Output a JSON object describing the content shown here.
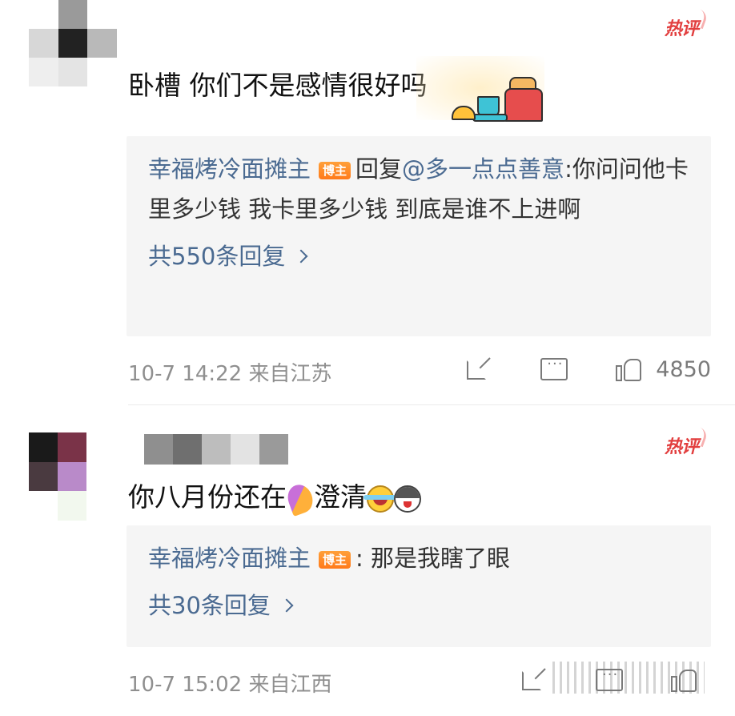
{
  "hot_badge": "热评",
  "comments": [
    {
      "text": "卧槽 你们不是感情很好吗",
      "reply": {
        "author": "幸福烤冷面摊主",
        "badge": "博主",
        "prefix": "回复",
        "mention": "@多一点点善意",
        "body": ":你问问他卡里多少钱 我卡里多少钱 到底是谁不上进啊",
        "count_label": "共550条回复"
      },
      "meta": "10-7 14:22 来自江苏",
      "likes": "4850"
    },
    {
      "text_before": "你八月份还在",
      "text_after": "澄清",
      "reply": {
        "author": "幸福烤冷面摊主",
        "badge": "博主",
        "body": ": 那是我瞎了眼",
        "count_label": "共30条回复"
      },
      "meta": "10-7 15:02 来自江西",
      "likes": ""
    }
  ]
}
